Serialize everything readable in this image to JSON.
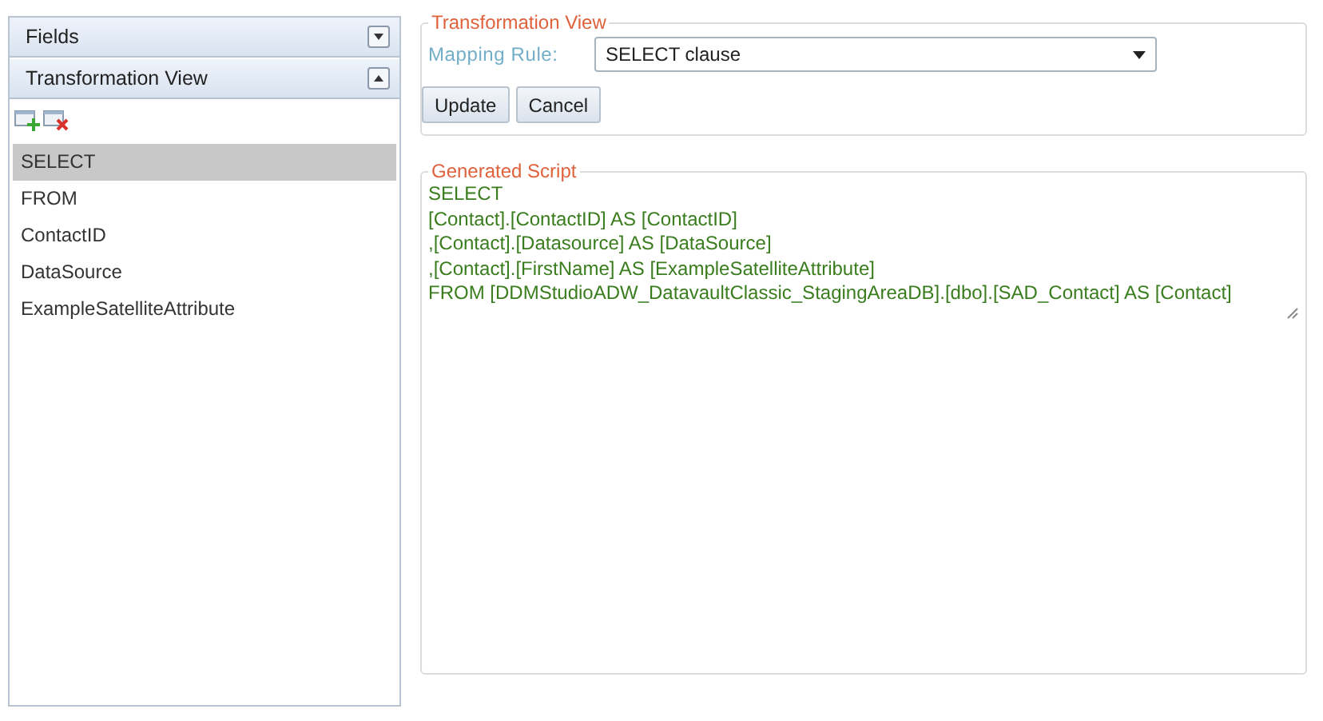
{
  "sidebar": {
    "sections": [
      {
        "title": "Fields",
        "expanded": false
      },
      {
        "title": "Transformation View",
        "expanded": true
      }
    ],
    "items": [
      {
        "label": "SELECT",
        "selected": true
      },
      {
        "label": "FROM",
        "selected": false
      },
      {
        "label": "ContactID",
        "selected": false
      },
      {
        "label": "DataSource",
        "selected": false
      },
      {
        "label": "ExampleSatelliteAttribute",
        "selected": false
      }
    ]
  },
  "transformation_view": {
    "title": "Transformation View",
    "mapping_rule_label": "Mapping Rule:",
    "mapping_rule_value": "SELECT clause",
    "buttons": [
      "Update",
      "Cancel"
    ]
  },
  "generated_script": {
    "title": "Generated Script",
    "lines": [
      "SELECT",
      "[Contact].[ContactID] AS [ContactID]",
      ",[Contact].[Datasource] AS [DataSource]",
      ",[Contact].[FirstName] AS [ExampleSatelliteAttribute]",
      "FROM [DDMStudioADW_DatavaultClassic_StagingAreaDB].[dbo].[SAD_Contact] AS [Contact]"
    ]
  }
}
